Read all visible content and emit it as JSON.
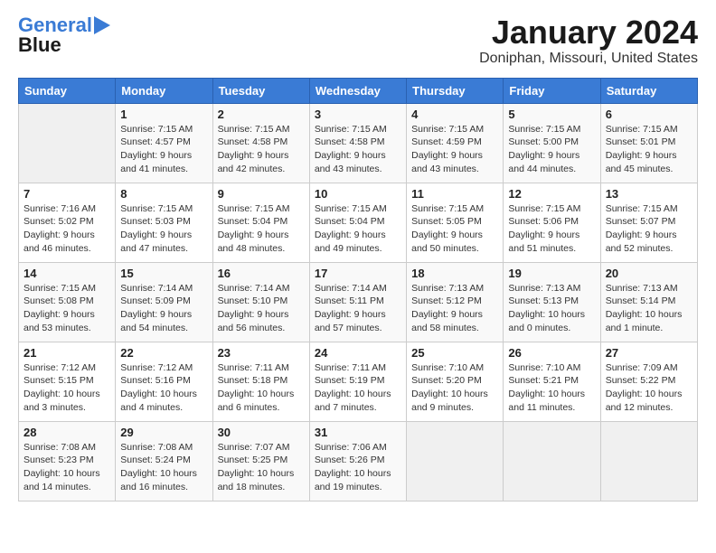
{
  "header": {
    "logo_line1": "General",
    "logo_line2": "Blue",
    "month": "January 2024",
    "location": "Doniphan, Missouri, United States"
  },
  "weekdays": [
    "Sunday",
    "Monday",
    "Tuesday",
    "Wednesday",
    "Thursday",
    "Friday",
    "Saturday"
  ],
  "weeks": [
    [
      {
        "day": "",
        "info": ""
      },
      {
        "day": "1",
        "info": "Sunrise: 7:15 AM\nSunset: 4:57 PM\nDaylight: 9 hours\nand 41 minutes."
      },
      {
        "day": "2",
        "info": "Sunrise: 7:15 AM\nSunset: 4:58 PM\nDaylight: 9 hours\nand 42 minutes."
      },
      {
        "day": "3",
        "info": "Sunrise: 7:15 AM\nSunset: 4:58 PM\nDaylight: 9 hours\nand 43 minutes."
      },
      {
        "day": "4",
        "info": "Sunrise: 7:15 AM\nSunset: 4:59 PM\nDaylight: 9 hours\nand 43 minutes."
      },
      {
        "day": "5",
        "info": "Sunrise: 7:15 AM\nSunset: 5:00 PM\nDaylight: 9 hours\nand 44 minutes."
      },
      {
        "day": "6",
        "info": "Sunrise: 7:15 AM\nSunset: 5:01 PM\nDaylight: 9 hours\nand 45 minutes."
      }
    ],
    [
      {
        "day": "7",
        "info": "Sunrise: 7:16 AM\nSunset: 5:02 PM\nDaylight: 9 hours\nand 46 minutes."
      },
      {
        "day": "8",
        "info": "Sunrise: 7:15 AM\nSunset: 5:03 PM\nDaylight: 9 hours\nand 47 minutes."
      },
      {
        "day": "9",
        "info": "Sunrise: 7:15 AM\nSunset: 5:04 PM\nDaylight: 9 hours\nand 48 minutes."
      },
      {
        "day": "10",
        "info": "Sunrise: 7:15 AM\nSunset: 5:04 PM\nDaylight: 9 hours\nand 49 minutes."
      },
      {
        "day": "11",
        "info": "Sunrise: 7:15 AM\nSunset: 5:05 PM\nDaylight: 9 hours\nand 50 minutes."
      },
      {
        "day": "12",
        "info": "Sunrise: 7:15 AM\nSunset: 5:06 PM\nDaylight: 9 hours\nand 51 minutes."
      },
      {
        "day": "13",
        "info": "Sunrise: 7:15 AM\nSunset: 5:07 PM\nDaylight: 9 hours\nand 52 minutes."
      }
    ],
    [
      {
        "day": "14",
        "info": "Sunrise: 7:15 AM\nSunset: 5:08 PM\nDaylight: 9 hours\nand 53 minutes."
      },
      {
        "day": "15",
        "info": "Sunrise: 7:14 AM\nSunset: 5:09 PM\nDaylight: 9 hours\nand 54 minutes."
      },
      {
        "day": "16",
        "info": "Sunrise: 7:14 AM\nSunset: 5:10 PM\nDaylight: 9 hours\nand 56 minutes."
      },
      {
        "day": "17",
        "info": "Sunrise: 7:14 AM\nSunset: 5:11 PM\nDaylight: 9 hours\nand 57 minutes."
      },
      {
        "day": "18",
        "info": "Sunrise: 7:13 AM\nSunset: 5:12 PM\nDaylight: 9 hours\nand 58 minutes."
      },
      {
        "day": "19",
        "info": "Sunrise: 7:13 AM\nSunset: 5:13 PM\nDaylight: 10 hours\nand 0 minutes."
      },
      {
        "day": "20",
        "info": "Sunrise: 7:13 AM\nSunset: 5:14 PM\nDaylight: 10 hours\nand 1 minute."
      }
    ],
    [
      {
        "day": "21",
        "info": "Sunrise: 7:12 AM\nSunset: 5:15 PM\nDaylight: 10 hours\nand 3 minutes."
      },
      {
        "day": "22",
        "info": "Sunrise: 7:12 AM\nSunset: 5:16 PM\nDaylight: 10 hours\nand 4 minutes."
      },
      {
        "day": "23",
        "info": "Sunrise: 7:11 AM\nSunset: 5:18 PM\nDaylight: 10 hours\nand 6 minutes."
      },
      {
        "day": "24",
        "info": "Sunrise: 7:11 AM\nSunset: 5:19 PM\nDaylight: 10 hours\nand 7 minutes."
      },
      {
        "day": "25",
        "info": "Sunrise: 7:10 AM\nSunset: 5:20 PM\nDaylight: 10 hours\nand 9 minutes."
      },
      {
        "day": "26",
        "info": "Sunrise: 7:10 AM\nSunset: 5:21 PM\nDaylight: 10 hours\nand 11 minutes."
      },
      {
        "day": "27",
        "info": "Sunrise: 7:09 AM\nSunset: 5:22 PM\nDaylight: 10 hours\nand 12 minutes."
      }
    ],
    [
      {
        "day": "28",
        "info": "Sunrise: 7:08 AM\nSunset: 5:23 PM\nDaylight: 10 hours\nand 14 minutes."
      },
      {
        "day": "29",
        "info": "Sunrise: 7:08 AM\nSunset: 5:24 PM\nDaylight: 10 hours\nand 16 minutes."
      },
      {
        "day": "30",
        "info": "Sunrise: 7:07 AM\nSunset: 5:25 PM\nDaylight: 10 hours\nand 18 minutes."
      },
      {
        "day": "31",
        "info": "Sunrise: 7:06 AM\nSunset: 5:26 PM\nDaylight: 10 hours\nand 19 minutes."
      },
      {
        "day": "",
        "info": ""
      },
      {
        "day": "",
        "info": ""
      },
      {
        "day": "",
        "info": ""
      }
    ]
  ]
}
